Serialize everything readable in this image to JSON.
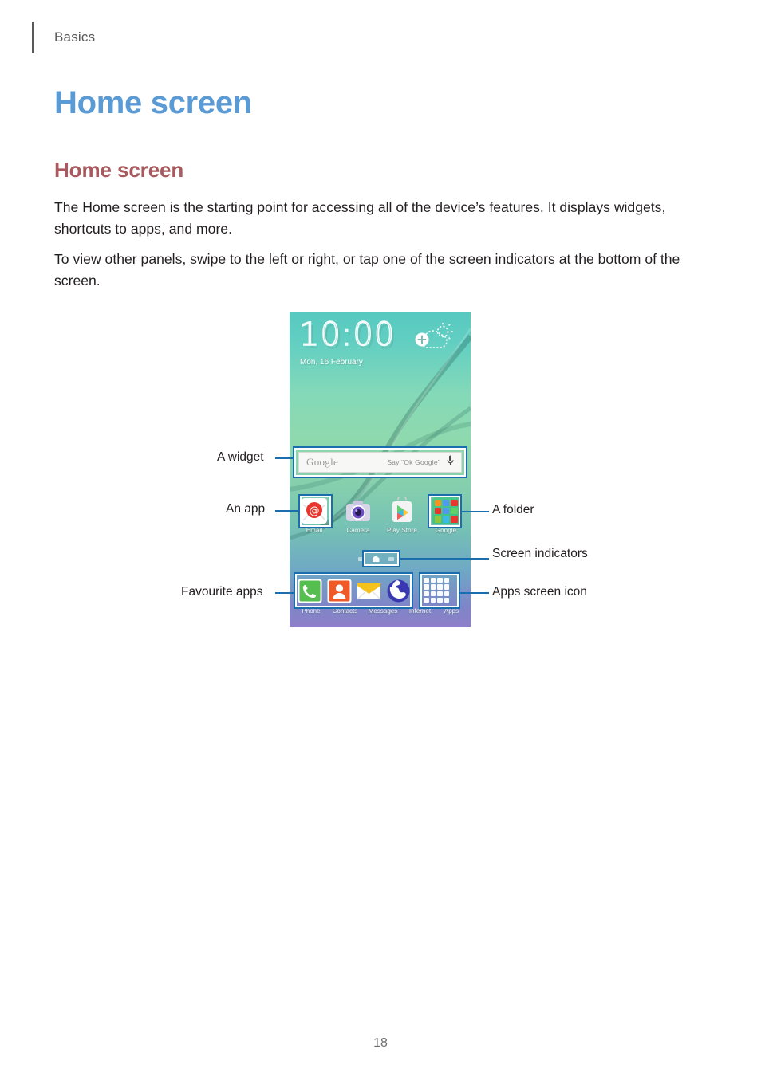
{
  "header": {
    "section": "Basics"
  },
  "titles": {
    "chapter": "Home screen",
    "section": "Home screen"
  },
  "paragraphs": {
    "p1": "The Home screen is the starting point for accessing all of the device’s features. It displays widgets, shortcuts to apps, and more.",
    "p2": "To view other panels, swipe to the left or right, or tap one of the screen indicators at the bottom of the screen."
  },
  "figure": {
    "callouts": {
      "widget": "A widget",
      "app": "An app",
      "favourite_apps": "Favourite apps",
      "folder": "A folder",
      "screen_indicators": "Screen indicators",
      "apps_screen_icon": "Apps screen icon"
    },
    "phone": {
      "clock": "10:00",
      "date": "Mon, 16 February",
      "weather_icon": "add-weather-icon",
      "search_widget": {
        "logo": "Google",
        "hint": "Say \"Ok Google\"",
        "mic_icon": "microphone-icon"
      },
      "apps": [
        {
          "label": "Email",
          "icon": "email-icon"
        },
        {
          "label": "Camera",
          "icon": "camera-icon"
        },
        {
          "label": "Play Store",
          "icon": "play-store-icon"
        },
        {
          "label": "Google",
          "icon": "google-folder-icon"
        }
      ],
      "indicators": {
        "count": 3,
        "active_index": 1
      },
      "dock": [
        {
          "label": "Phone",
          "icon": "phone-icon"
        },
        {
          "label": "Contacts",
          "icon": "contacts-icon"
        },
        {
          "label": "Messages",
          "icon": "messages-icon"
        },
        {
          "label": "Internet",
          "icon": "internet-icon"
        },
        {
          "label": "Apps",
          "icon": "apps-grid-icon"
        }
      ]
    }
  },
  "footer": {
    "page_number": "18"
  },
  "colors": {
    "chapter_title": "#5b9bd5",
    "section_title": "#a85a5f",
    "callout_line": "#1b6eae",
    "body_text": "#231f20"
  }
}
